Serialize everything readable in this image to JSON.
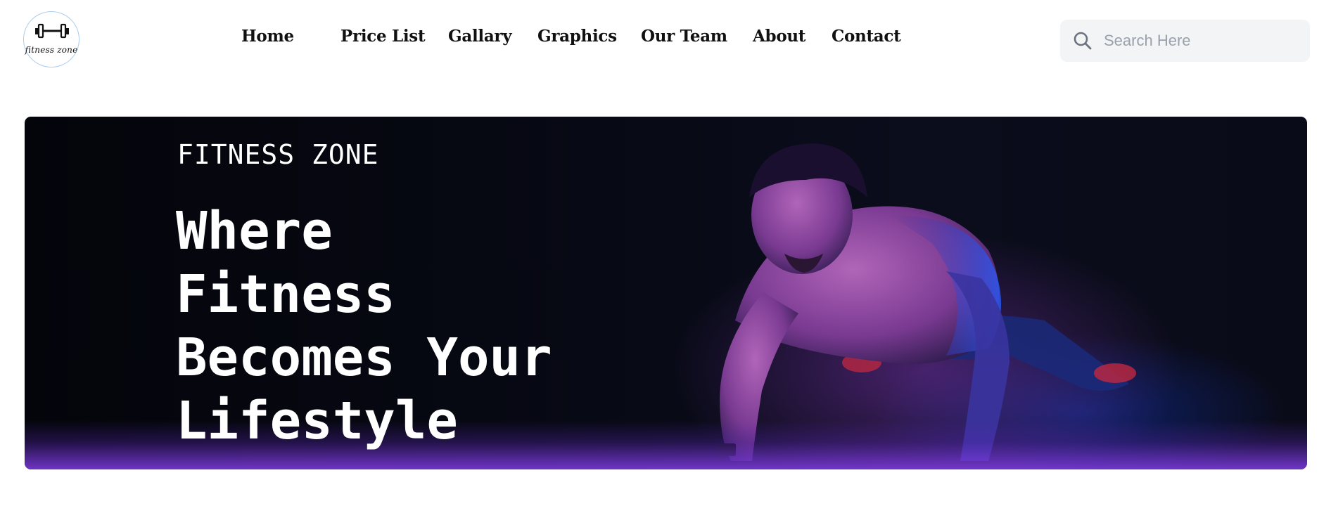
{
  "brand": {
    "logo_text": "fitness zone",
    "logo_icon": "dumbbell-icon",
    "ring_color": "#a9cdee"
  },
  "nav": {
    "items": [
      {
        "label": "Home"
      },
      {
        "label": "Price List"
      },
      {
        "label": "Gallary"
      },
      {
        "label": "Graphics"
      },
      {
        "label": "Our Team"
      },
      {
        "label": "About"
      },
      {
        "label": "Contact"
      }
    ]
  },
  "search": {
    "placeholder": "Search Here",
    "value": "",
    "icon": "search-icon"
  },
  "hero": {
    "eyebrow": "FITNESS ZONE",
    "headline_lines": [
      "Where",
      "Fitness",
      "Becomes Your",
      "Lifestyle"
    ],
    "accent_colors": [
      "#7a32aa",
      "#143cd2",
      "#823ce6"
    ]
  }
}
